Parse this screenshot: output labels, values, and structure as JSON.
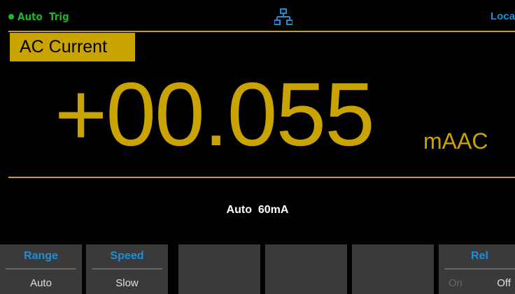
{
  "status": {
    "trigger": "Auto  Trig",
    "trigger_color": "#1fb52a",
    "network_icon": "lan-icon",
    "mode": "Loca",
    "mode_color": "#1e8fd6"
  },
  "function": {
    "label": "AC Current",
    "accent": "#c9a400"
  },
  "measurement": {
    "value": "+00.055",
    "unit": "mAAC"
  },
  "range_info": "Auto  60mA",
  "softkeys": [
    {
      "label": "Range",
      "value": "Auto"
    },
    {
      "label": "Speed",
      "value": "Slow"
    },
    {
      "label": "",
      "value": ""
    },
    {
      "label": "",
      "value": ""
    },
    {
      "label": "",
      "value": ""
    },
    {
      "label": "Rel",
      "on": "On",
      "off": "Off"
    }
  ]
}
